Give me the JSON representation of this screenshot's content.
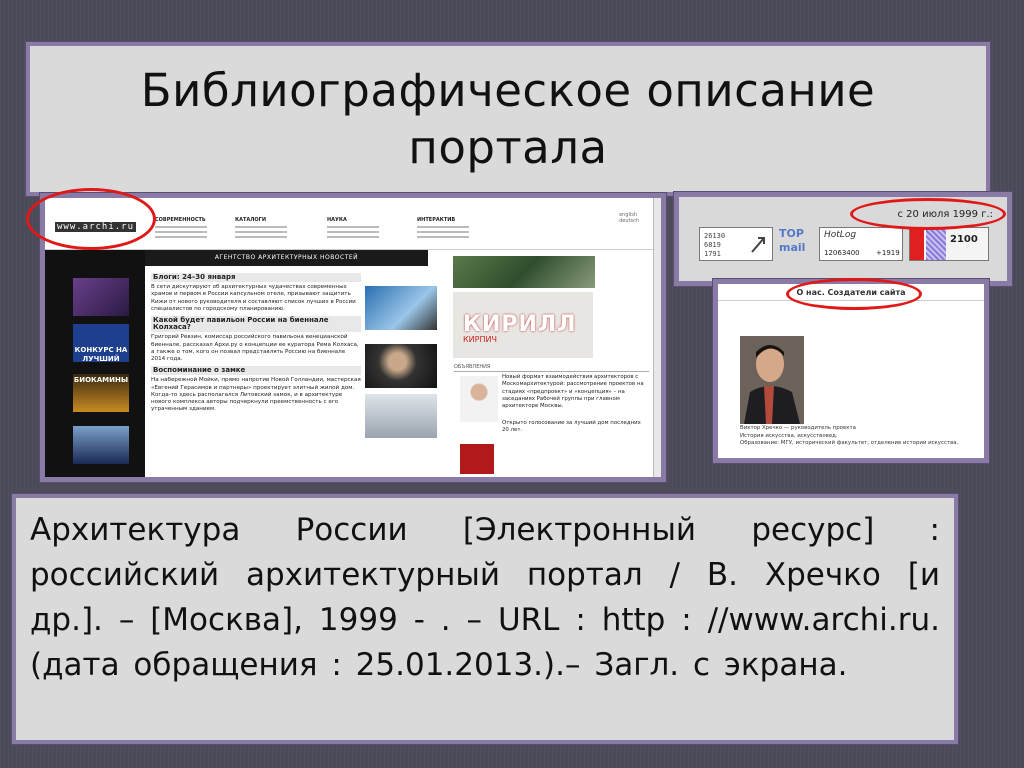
{
  "slide": {
    "title": "Библиографическое описание\nпортала",
    "citation": "Архитектура России [Электронный ресурс] : российский архитектурный портал / В. Хречко [и др.]. – [Москва], 1999 - . – URL : http : //www.archi.ru. (дата обращения : 25.01.2013.).– Загл. с экрана."
  },
  "site": {
    "logo": "www.archi.ru",
    "nav": [
      {
        "heading": "СОВРЕМЕННОСТЬ"
      },
      {
        "heading": "КАТАЛОГИ"
      },
      {
        "heading": "НАУКА"
      },
      {
        "heading": "ИНТЕРАКТИВ"
      }
    ],
    "lang": "english\ndeutsch",
    "news_bar": "АГЕНТСТВО АРХИТЕКТУРНЫХ НОВОСТЕЙ",
    "left_banners": [
      "КОНКУРС НА ЛУЧШИЙ",
      "БИОКАМИНЫ"
    ],
    "news": [
      {
        "heading": "Блоги: 24–30 января",
        "text": "В сети дискутируют об архитектурных чудачествах современных храмов и первом в России капсульном отеле, призывают защитить Кижи от нового руководителя и составляют список лучших в России специалистов по городскому планированию."
      },
      {
        "heading": "Какой будет павильон России на биеннале Колхаса?",
        "text": "Григорий Ревзин, комиссар российского павильона венецианской биеннале, рассказал Архи.ру о концепции ее куратора Рема Колхаса, а также о том, кого он позвал представлять Россию на биеннале 2014 года."
      },
      {
        "heading": "Воспоминание о замке",
        "text": "На набережной Мойки, прямо напротив Новой Голландии, мастерская «Евгений Герасимов и партнеры» проектирует элитный жилой дом. Когда-то здесь располагался Литовский замок, и в архитектуре нового комплекса авторы подчеркнули преемственность с его утраченным зданием."
      }
    ],
    "ad_brand": "КИРИЛЛ",
    "ad_brand_sub": "КИРПИЧ",
    "ads_heading": "ОБЪЯВЛЕНИЯ",
    "ads": [
      {
        "text": "Новый формат взаимодействия архитекторов с Москомархитектурой: рассмотрение проектов на стадиях «предпроект» и «концепция» – на заседаниях Рабочей группы при главном архитекторе Москвы."
      },
      {
        "text": "Открыто голосование за лучший дом последних 20 лет."
      }
    ]
  },
  "counters": {
    "date": "с 20 июля 1999 г.:",
    "top_mail": "TOP mail",
    "hotlog": "HotLog",
    "hotlog_num": "12063400",
    "hotlog_plus": "+1919",
    "ya_num": "2100"
  },
  "about": {
    "heading": "О нас. Создатели сайта",
    "text": "Виктор Хречко — руководитель проекта\nИстория искусства, искусствовед.\nОбразование: МГУ, исторический факультет, отделение истории искусства."
  },
  "colors": {
    "frame": "#8a7aa6",
    "highlight": "#e01818",
    "background": "#4a4a58"
  }
}
